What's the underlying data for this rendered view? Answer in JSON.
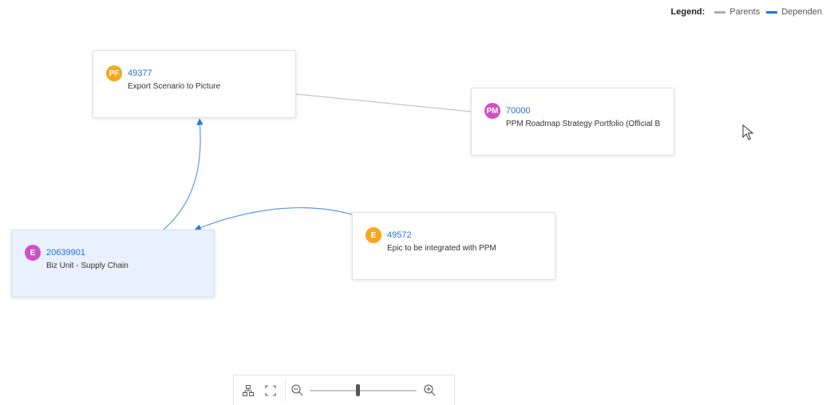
{
  "legend": {
    "title": "Legend:",
    "items": [
      {
        "label": "Parents",
        "color": "#aaaaaa"
      },
      {
        "label": "Dependen",
        "color": "#1a73e8"
      }
    ]
  },
  "nodes": [
    {
      "badge": "PF",
      "badge_color": "#f5a623",
      "id": "49377",
      "label": "Export Scenario to Picture",
      "selected": false
    },
    {
      "badge": "PM",
      "badge_color": "#d14fc6",
      "id": "70000",
      "label": "PPM Roadmap Strategy Portfolio (Official B",
      "selected": false
    },
    {
      "badge": "E",
      "badge_color": "#f5a623",
      "id": "49572",
      "label": "Epic to be integrated with PPM",
      "selected": false
    },
    {
      "badge": "E",
      "badge_color": "#d14fc6",
      "id": "20639901",
      "label": "Biz Unit - Supply Chain",
      "selected": true
    }
  ],
  "edges": [
    {
      "from": "49377",
      "to": "70000",
      "kind": "parent",
      "color": "#c4c4c4"
    },
    {
      "from": "20639901",
      "to": "49377",
      "kind": "dependency",
      "color": "#5b9be6"
    },
    {
      "from": "49572",
      "to": "20639901",
      "kind": "dependency",
      "color": "#5b9be6"
    }
  ],
  "toolbar": {
    "layout_icon": "hierarchy-icon",
    "fit_icon": "fit-screen-icon",
    "zoom_out_icon": "zoom-out-icon",
    "zoom_in_icon": "zoom-in-icon",
    "zoom_level": 0.45
  }
}
